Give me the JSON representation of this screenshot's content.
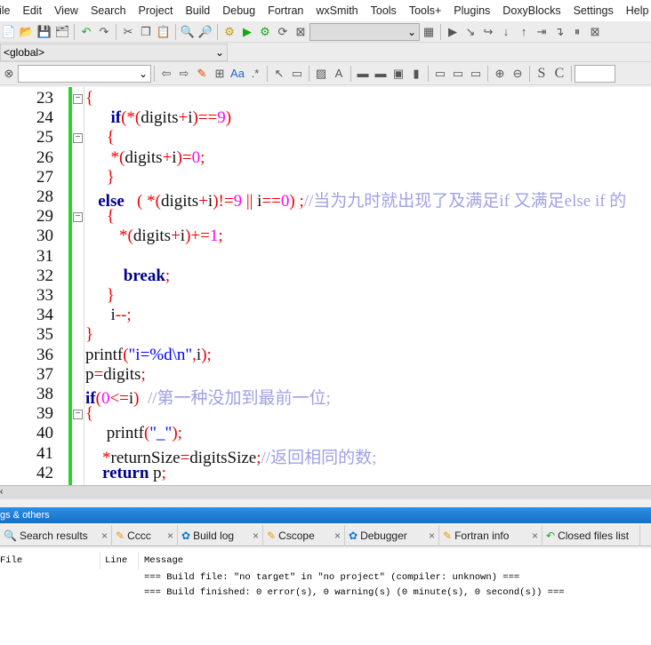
{
  "menu": [
    "ile",
    "Edit",
    "View",
    "Search",
    "Project",
    "Build",
    "Debug",
    "Fortran",
    "wxSmith",
    "Tools",
    "Tools+",
    "Plugins",
    "DoxyBlocks",
    "Settings",
    "Help"
  ],
  "scope_combo": "<global>",
  "editor": {
    "line_numbers": [
      23,
      24,
      25,
      26,
      27,
      28,
      29,
      30,
      31,
      32,
      33,
      34,
      35,
      36,
      37,
      38,
      39,
      40,
      41,
      42
    ],
    "fold_markers": [
      23,
      25,
      29,
      39
    ],
    "lines": [
      [
        [
          "op",
          "{"
        ]
      ],
      [
        [
          "id",
          "      "
        ],
        [
          "kw",
          "if"
        ],
        [
          "op",
          "(*("
        ],
        [
          "id",
          "digits"
        ],
        [
          "op",
          "+"
        ],
        [
          "id",
          "i"
        ],
        [
          "op",
          ")=="
        ],
        [
          "num",
          "9"
        ],
        [
          "op",
          ")"
        ]
      ],
      [
        [
          "id",
          "     "
        ],
        [
          "op",
          "{"
        ]
      ],
      [
        [
          "id",
          "      "
        ],
        [
          "op",
          "*("
        ],
        [
          "id",
          "digits"
        ],
        [
          "op",
          "+"
        ],
        [
          "id",
          "i"
        ],
        [
          "op",
          ")="
        ],
        [
          "num",
          "0"
        ],
        [
          "op",
          ";"
        ]
      ],
      [
        [
          "id",
          "     "
        ],
        [
          "op",
          "}"
        ]
      ],
      [
        [
          "id",
          "   "
        ],
        [
          "kw",
          "else"
        ],
        [
          "id",
          "   "
        ],
        [
          "op",
          "( *("
        ],
        [
          "id",
          "digits"
        ],
        [
          "op",
          "+"
        ],
        [
          "id",
          "i"
        ],
        [
          "op",
          ")!="
        ],
        [
          "num",
          "9"
        ],
        [
          "op",
          " || "
        ],
        [
          "id",
          "i"
        ],
        [
          "op",
          "=="
        ],
        [
          "num",
          "0"
        ],
        [
          "op",
          ") ;"
        ],
        [
          "cm",
          "//当为九时就出现了及满足if 又满足else if 的"
        ]
      ],
      [
        [
          "id",
          "     "
        ],
        [
          "op",
          "{"
        ]
      ],
      [
        [
          "id",
          "        "
        ],
        [
          "op",
          "*("
        ],
        [
          "id",
          "digits"
        ],
        [
          "op",
          "+"
        ],
        [
          "id",
          "i"
        ],
        [
          "op",
          ")+="
        ],
        [
          "num",
          "1"
        ],
        [
          "op",
          ";"
        ]
      ],
      [
        [
          "id",
          ""
        ]
      ],
      [
        [
          "id",
          "         "
        ],
        [
          "kw",
          "break"
        ],
        [
          "op",
          ";"
        ]
      ],
      [
        [
          "id",
          "     "
        ],
        [
          "op",
          "}"
        ]
      ],
      [
        [
          "id",
          "      "
        ],
        [
          "id",
          "i"
        ],
        [
          "op",
          "--;"
        ]
      ],
      [
        [
          "op",
          "}"
        ]
      ],
      [
        [
          "id",
          "printf"
        ],
        [
          "op",
          "("
        ],
        [
          "str",
          "\"i=%d\\n\""
        ],
        [
          "op",
          ","
        ],
        [
          "id",
          "i"
        ],
        [
          "op",
          ");"
        ]
      ],
      [
        [
          "id",
          "p"
        ],
        [
          "op",
          "="
        ],
        [
          "id",
          "digits"
        ],
        [
          "op",
          ";"
        ]
      ],
      [
        [
          "kw",
          "if"
        ],
        [
          "op",
          "("
        ],
        [
          "num",
          "0"
        ],
        [
          "op",
          "<="
        ],
        [
          "id",
          "i"
        ],
        [
          "op",
          ")  "
        ],
        [
          "cm",
          "//第一种没加到最前一位;"
        ]
      ],
      [
        [
          "op",
          "{"
        ]
      ],
      [
        [
          "id",
          "     "
        ],
        [
          "id",
          "printf"
        ],
        [
          "op",
          "("
        ],
        [
          "str",
          "\"_\""
        ],
        [
          "op",
          ");"
        ]
      ],
      [
        [
          "id",
          "    "
        ],
        [
          "op",
          "*"
        ],
        [
          "id",
          "returnSize"
        ],
        [
          "op",
          "="
        ],
        [
          "id",
          "digitsSize"
        ],
        [
          "op",
          ";"
        ],
        [
          "cm",
          "//返回相同的数;"
        ]
      ],
      [
        [
          "id",
          "    "
        ],
        [
          "kw",
          "return"
        ],
        [
          "id",
          " p"
        ],
        [
          "op",
          ";"
        ]
      ]
    ]
  },
  "panel": {
    "title": "gs & others",
    "tabs": [
      {
        "label": "Search results",
        "icon": "magnifier-icon"
      },
      {
        "label": "Cccc",
        "icon": "pencil-icon"
      },
      {
        "label": "Build log",
        "icon": "gear-icon"
      },
      {
        "label": "Cscope",
        "icon": "pencil-icon"
      },
      {
        "label": "Debugger",
        "icon": "gear-icon"
      },
      {
        "label": "Fortran info",
        "icon": "pencil-icon"
      },
      {
        "label": "Closed files list",
        "icon": "arrow-icon"
      }
    ],
    "columns": [
      "File",
      "Line",
      "Message"
    ],
    "messages": [
      "=== Build file: \"no target\" in \"no project\" (compiler: unknown) ===",
      "=== Build finished: 0 error(s), 0 warning(s) (0 minute(s), 0 second(s)) ==="
    ]
  },
  "colors": {
    "keyword": "#00008b",
    "operator": "#ee0000",
    "number": "#ff00ff",
    "string": "#0000ff",
    "comment": "#a0a0e8",
    "change_bar": "#2bd42b",
    "panel_title": "#1f7fd8"
  }
}
